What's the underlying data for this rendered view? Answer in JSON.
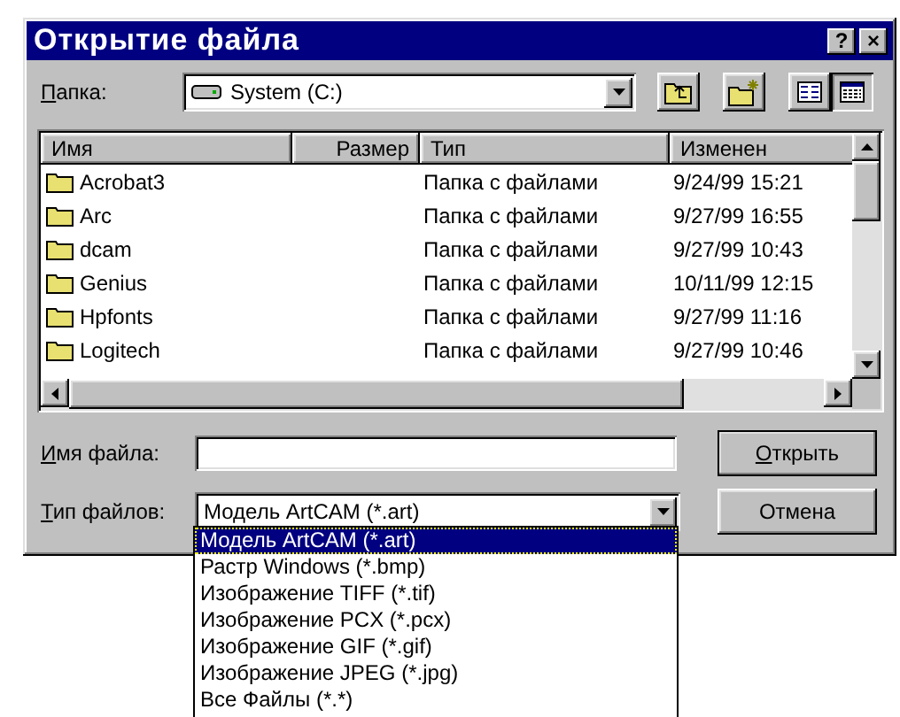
{
  "window": {
    "title": "Открытие файла",
    "title_buttons": [
      "?",
      "×"
    ]
  },
  "folder": {
    "label": "Папка:",
    "value": "System (C:)"
  },
  "view_buttons": [
    {
      "kind": "list",
      "selected": false
    },
    {
      "kind": "details",
      "selected": true
    }
  ],
  "file_list": {
    "columns": [
      "Имя",
      "Размер",
      "Тип",
      "Изменен"
    ],
    "rows": [
      {
        "name": "Acrobat3",
        "type": "Папка с файлами",
        "modified": "9/24/99 15:21"
      },
      {
        "name": "Arc",
        "type": "Папка с файлами",
        "modified": "9/27/99 16:55"
      },
      {
        "name": "dcam",
        "type": "Папка с файлами",
        "modified": "9/27/99 10:43"
      },
      {
        "name": "Genius",
        "type": "Папка с файлами",
        "modified": "10/11/99 12:15"
      },
      {
        "name": "Hpfonts",
        "type": "Папка с файлами",
        "modified": "9/27/99 11:16"
      },
      {
        "name": "Logitech",
        "type": "Папка с файлами",
        "modified": "9/27/99 10:46"
      }
    ]
  },
  "file_name": {
    "label": "Имя файла:"
  },
  "file_type": {
    "label": "Тип файлов:",
    "value": "Модель ArtCAM (*.art)",
    "expanded": true,
    "options": [
      {
        "label": "Модель ArtCAM (*.art)",
        "selected": true
      },
      {
        "label": "Растр Windows (*.bmp)",
        "selected": false
      },
      {
        "label": "Изображение TIFF (*.tif)",
        "selected": false
      },
      {
        "label": "Изображение PCX (*.pcx)",
        "selected": false
      },
      {
        "label": "Изображение GIF (*.gif)",
        "selected": false
      },
      {
        "label": "Изображение JPEG (*.jpg)",
        "selected": false
      },
      {
        "label": "Все Файлы (*.*)",
        "selected": false
      }
    ]
  },
  "buttons": [
    {
      "label": "Открыть",
      "default": true
    },
    {
      "label": "Отмена",
      "default": false
    }
  ]
}
